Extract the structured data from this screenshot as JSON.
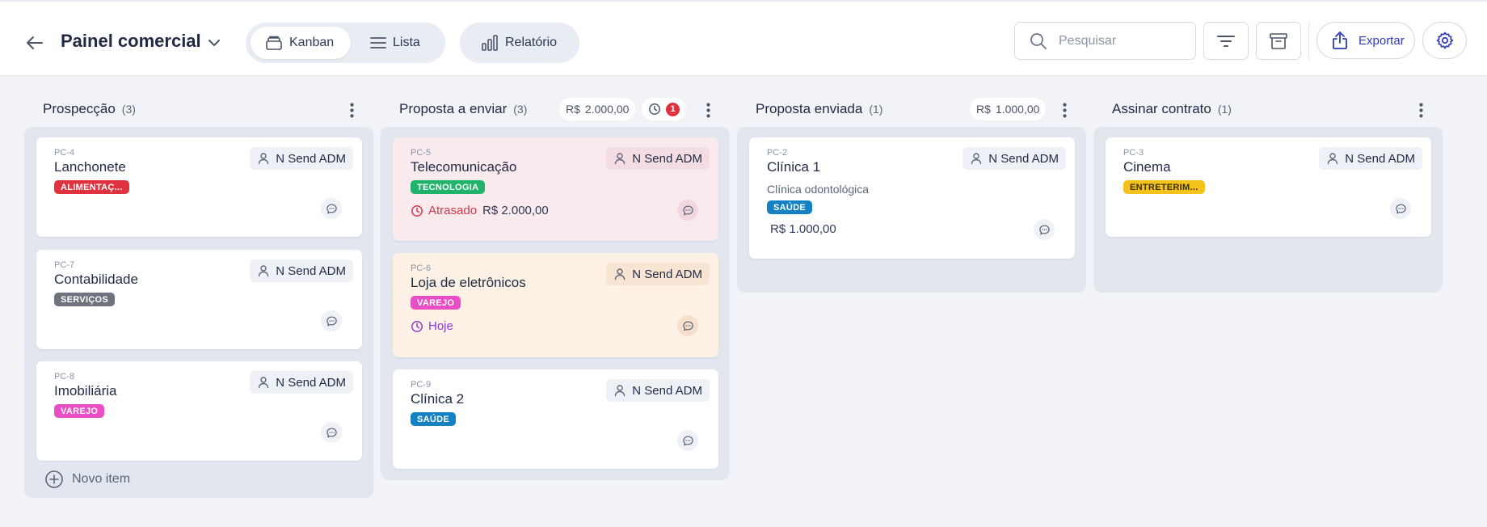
{
  "header": {
    "title": "Painel comercial",
    "views": {
      "kanban": "Kanban",
      "lista": "Lista",
      "relatorio": "Relatório"
    },
    "search_placeholder": "Pesquisar",
    "export_label": "Exportar"
  },
  "colors": {
    "accent": "#2e3bbf",
    "overdue": "#d23545",
    "today": "#8a3bd6",
    "tag_alimentacao": "#e0323e",
    "tag_servicos": "#6e737d",
    "tag_varejo": "#e94ec4",
    "tag_tecnologia": "#1fb46a",
    "tag_saude": "#1381c2",
    "tag_entreterimento": "#f3c21b"
  },
  "columns": [
    {
      "name": "Prospecção",
      "count": "(3)",
      "cards": [
        {
          "code": "PC-4",
          "name": "Lanchonete",
          "tag": "ALIMENTAÇ...",
          "assignee": "N Send ADM"
        },
        {
          "code": "PC-7",
          "name": "Contabilidade",
          "tag": "SERVIÇOS",
          "assignee": "N Send ADM"
        },
        {
          "code": "PC-8",
          "name": "Imobiliária",
          "tag": "VAREJO",
          "assignee": "N Send ADM"
        }
      ],
      "new_item": "Novo item"
    },
    {
      "name": "Proposta a enviar",
      "count": "(3)",
      "currency": "R$",
      "total": "2.000,00",
      "overdue_badge": "1",
      "cards": [
        {
          "code": "PC-5",
          "name": "Telecomunicação",
          "tag": "TECNOLOGIA",
          "assignee": "N Send ADM",
          "status": "Atrasado",
          "value": "R$ 2.000,00"
        },
        {
          "code": "PC-6",
          "name": "Loja de eletrônicos",
          "tag": "VAREJO",
          "assignee": "N Send ADM",
          "status": "Hoje"
        },
        {
          "code": "PC-9",
          "name": "Clínica 2",
          "tag": "SAÚDE",
          "assignee": "N Send ADM"
        }
      ]
    },
    {
      "name": "Proposta enviada",
      "count": "(1)",
      "currency": "R$",
      "total": "1.000,00",
      "cards": [
        {
          "code": "PC-2",
          "name": "Clínica 1",
          "description": "Clínica odontológica",
          "tag": "SAÚDE",
          "assignee": "N Send ADM",
          "value": "R$ 1.000,00"
        }
      ]
    },
    {
      "name": "Assinar contrato",
      "count": "(1)",
      "cards": [
        {
          "code": "PC-3",
          "name": "Cinema",
          "tag": "ENTRETERIM...",
          "assignee": "N Send ADM"
        }
      ]
    }
  ]
}
